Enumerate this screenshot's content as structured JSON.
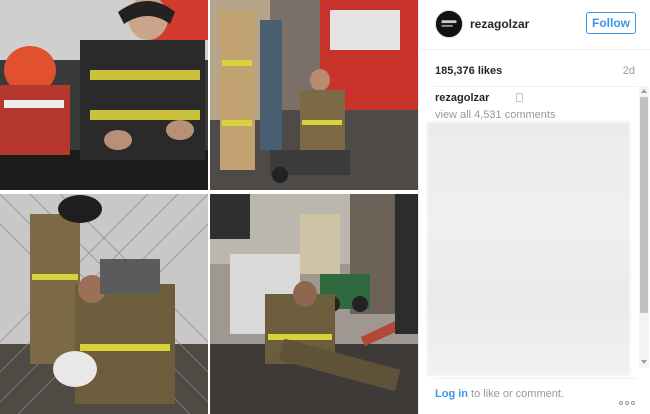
{
  "post": {
    "username": "rezagolzar",
    "follow_label": "Follow",
    "likes": "185,376 likes",
    "age": "2d",
    "caption_username": "rezagolzar",
    "view_comments": "view all 4,531 comments",
    "login_link": "Log in",
    "login_rest": " to like or comment."
  },
  "icons": {
    "avatar": "profile-avatar",
    "more": "more-options-icon"
  },
  "colors": {
    "accent": "#3897f0",
    "muted": "#999999",
    "text": "#262626"
  }
}
